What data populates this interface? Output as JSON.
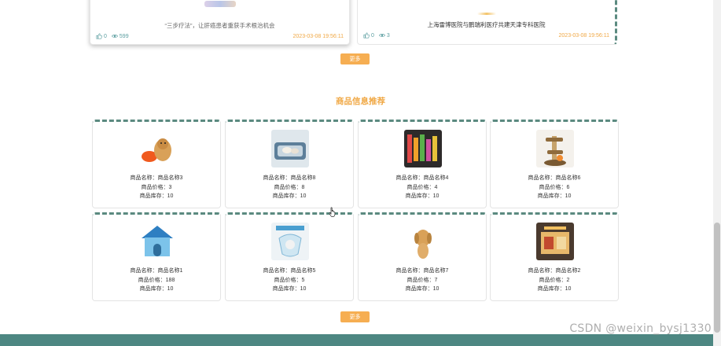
{
  "news": [
    {
      "title": "“三步疗法”，让肝癌患者重获手术根治机会",
      "likes": "0",
      "views": "599",
      "date": "2023-03-08 19:56:11"
    },
    {
      "title": "上海雷博医院与鹏瑞利医疗共建天津专科医院",
      "likes": "0",
      "views": "3",
      "date": "2023-03-08 19:56:11"
    }
  ],
  "news_more_label": "更多",
  "products_section_title": "商品信息推荐",
  "products": [
    {
      "name": "商品名称：商品名称3",
      "price": "商品价格：3",
      "stock": "商品库存：10",
      "image": "dog-with-frisbee"
    },
    {
      "name": "商品名称：商品名称8",
      "price": "商品价格：8",
      "stock": "商品库存：10",
      "image": "pet-bed"
    },
    {
      "name": "商品名称：商品名称4",
      "price": "商品价格：4",
      "stock": "商品库存：10",
      "image": "pet-toys-shelf"
    },
    {
      "name": "商品名称：商品名称6",
      "price": "商品价格：6",
      "stock": "商品库存：10",
      "image": "cat-tree"
    },
    {
      "name": "商品名称：商品名称1",
      "price": "商品价格：188",
      "stock": "商品库存：10",
      "image": "blue-dog-house"
    },
    {
      "name": "商品名称：商品名称5",
      "price": "商品价格：5",
      "stock": "商品库存：10",
      "image": "pet-cone-collar"
    },
    {
      "name": "商品名称：商品名称7",
      "price": "商品价格：7",
      "stock": "商品库存：10",
      "image": "golden-dog"
    },
    {
      "name": "商品名称：商品名称2",
      "price": "商品价格：2",
      "stock": "商品库存：10",
      "image": "pet-cabinet"
    }
  ],
  "products_more_label": "更多",
  "watermark": "CSDN @weixin_bysj1330",
  "colors": {
    "accent": "#f0a845",
    "button": "#f6ae52",
    "teal": "#4d8782",
    "dashed_border": "#5b8a80"
  }
}
